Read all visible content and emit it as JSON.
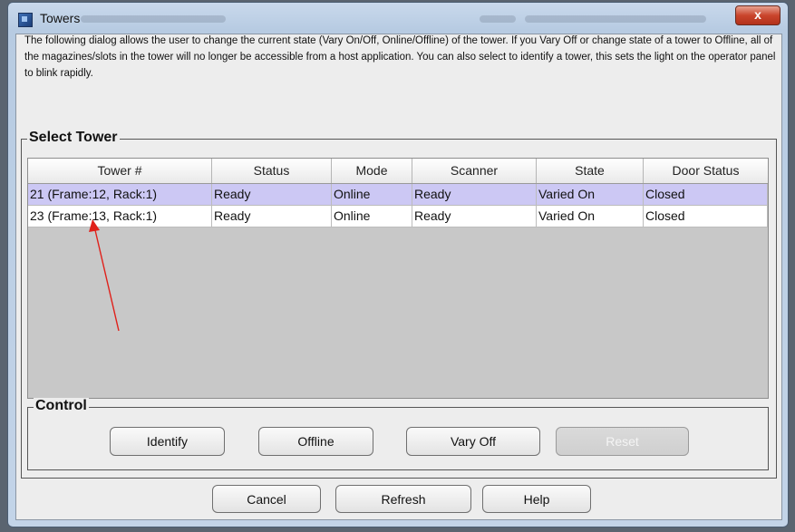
{
  "window": {
    "title": "Towers",
    "close_label": "x"
  },
  "description": "The following dialog allows the user to change the current state (Vary On/Off, Online/Offline) of the tower. If you Vary Off or change state of a tower to Offline, all of the magazines/slots in the tower will no longer be accessible from a host application. You can also select to identify a tower, this sets the light on the operator panel to blink rapidly.",
  "select_tower": {
    "title": "Select Tower",
    "columns": [
      "Tower #",
      "Status",
      "Mode",
      "Scanner",
      "State",
      "Door Status"
    ],
    "rows": [
      [
        "21 (Frame:12, Rack:1)",
        "Ready",
        "Online",
        "Ready",
        "Varied On",
        "Closed"
      ],
      [
        "23 (Frame:13, Rack:1)",
        "Ready",
        "Online",
        "Ready",
        "Varied On",
        "Closed"
      ]
    ],
    "selected_row": 0
  },
  "control": {
    "title": "Control",
    "identify": "Identify",
    "offline": "Offline",
    "vary_off": "Vary Off",
    "reset": "Reset"
  },
  "footer": {
    "cancel": "Cancel",
    "refresh": "Refresh",
    "help": "Help"
  },
  "colors": {
    "selected_row": "#ccc8f4",
    "annotation_arrow": "#e0201a",
    "close_button": "#c9452c"
  }
}
